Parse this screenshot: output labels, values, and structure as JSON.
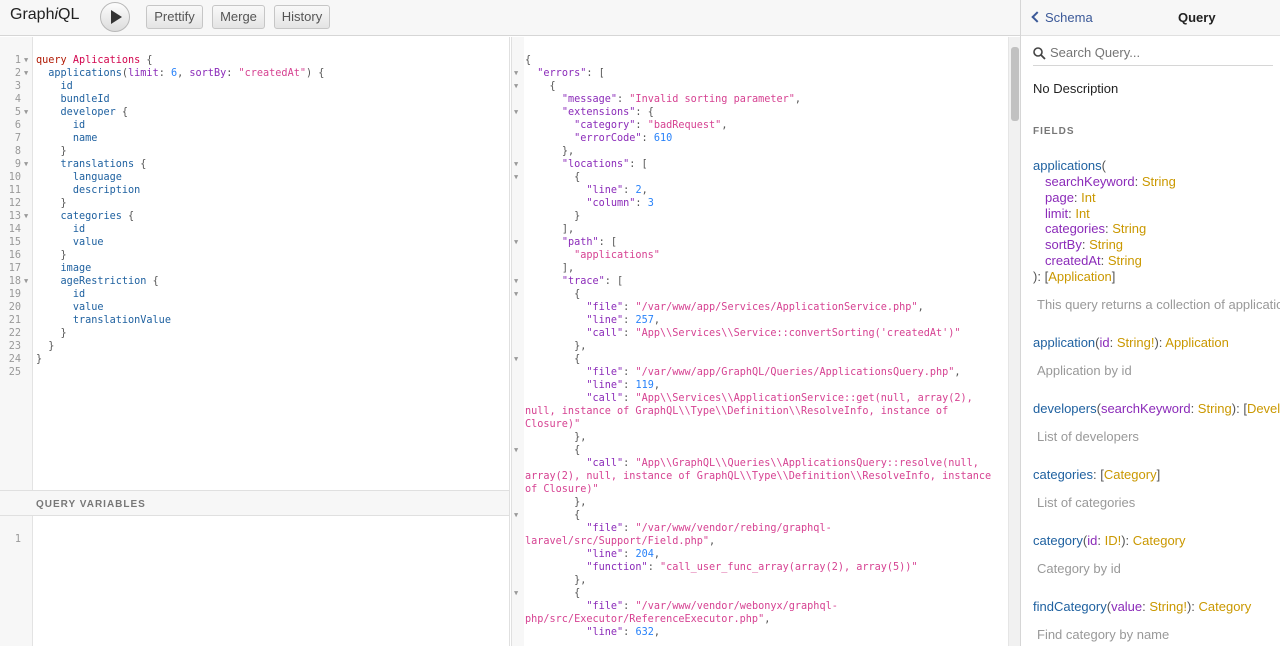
{
  "toolbar": {
    "logo_pre": "Graph",
    "logo_i": "i",
    "logo_post": "QL",
    "run_label": "",
    "prettify_label": "Prettify",
    "merge_label": "Merge",
    "history_label": "History"
  },
  "query_editor": {
    "lines": [
      {
        "n": "1",
        "fold": true,
        "code": "<span class='kw'>query</span> <span class='def'>Aplications</span> <span class='p'>{</span>"
      },
      {
        "n": "2",
        "fold": true,
        "code": "  <span class='field'>applications</span><span class='p'>(</span><span class='attr'>limit</span><span class='p'>:</span> <span class='num'>6</span><span class='p'>,</span> <span class='attr'>sortBy</span><span class='p'>:</span> <span class='str'>\"createdAt\"</span><span class='p'>) {</span>"
      },
      {
        "n": "3",
        "fold": false,
        "code": "    <span class='field'>id</span>"
      },
      {
        "n": "4",
        "fold": false,
        "code": "    <span class='field'>bundleId</span>"
      },
      {
        "n": "5",
        "fold": true,
        "code": "    <span class='field'>developer</span> <span class='p'>{</span>"
      },
      {
        "n": "6",
        "fold": false,
        "code": "      <span class='field'>id</span>"
      },
      {
        "n": "7",
        "fold": false,
        "code": "      <span class='field'>name</span>"
      },
      {
        "n": "8",
        "fold": false,
        "code": "    <span class='p'>}</span>"
      },
      {
        "n": "9",
        "fold": true,
        "code": "    <span class='field'>translations</span> <span class='p'>{</span>"
      },
      {
        "n": "10",
        "fold": false,
        "code": "      <span class='field'>language</span>"
      },
      {
        "n": "11",
        "fold": false,
        "code": "      <span class='field'>description</span>"
      },
      {
        "n": "12",
        "fold": false,
        "code": "    <span class='p'>}</span>"
      },
      {
        "n": "13",
        "fold": true,
        "code": "    <span class='field'>categories</span> <span class='p'>{</span>"
      },
      {
        "n": "14",
        "fold": false,
        "code": "      <span class='field'>id</span>"
      },
      {
        "n": "15",
        "fold": false,
        "code": "      <span class='field'>value</span>"
      },
      {
        "n": "16",
        "fold": false,
        "code": "    <span class='p'>}</span>"
      },
      {
        "n": "17",
        "fold": false,
        "code": "    <span class='field'>image</span>"
      },
      {
        "n": "18",
        "fold": true,
        "code": "    <span class='field'>ageRestriction</span> <span class='p'>{</span>"
      },
      {
        "n": "19",
        "fold": false,
        "code": "      <span class='field'>id</span>"
      },
      {
        "n": "20",
        "fold": false,
        "code": "      <span class='field'>value</span>"
      },
      {
        "n": "21",
        "fold": false,
        "code": "      <span class='field'>translationValue</span>"
      },
      {
        "n": "22",
        "fold": false,
        "code": "    <span class='p'>}</span>"
      },
      {
        "n": "23",
        "fold": false,
        "code": "  <span class='p'>}</span>"
      },
      {
        "n": "24",
        "fold": false,
        "code": "<span class='p'>}</span>"
      },
      {
        "n": "25",
        "fold": false,
        "code": ""
      }
    ]
  },
  "variables": {
    "title": "QUERY VARIABLES",
    "line_number": "1"
  },
  "result": {
    "lines": [
      {
        "fold": false,
        "code": "<span class='p'>{</span>"
      },
      {
        "fold": true,
        "code": "  <span class='attr'>\"errors\"</span><span class='p'>: [</span>"
      },
      {
        "fold": true,
        "code": "    <span class='p'>{</span>"
      },
      {
        "fold": false,
        "code": "      <span class='attr'>\"message\"</span><span class='p'>:</span> <span class='str'>\"Invalid sorting parameter\"</span><span class='p'>,</span>"
      },
      {
        "fold": true,
        "code": "      <span class='attr'>\"extensions\"</span><span class='p'>: {</span>"
      },
      {
        "fold": false,
        "code": "        <span class='attr'>\"category\"</span><span class='p'>:</span> <span class='str'>\"badRequest\"</span><span class='p'>,</span>"
      },
      {
        "fold": false,
        "code": "        <span class='attr'>\"errorCode\"</span><span class='p'>:</span> <span class='num'>610</span>"
      },
      {
        "fold": false,
        "code": "      <span class='p'>},</span>"
      },
      {
        "fold": true,
        "code": "      <span class='attr'>\"locations\"</span><span class='p'>: [</span>"
      },
      {
        "fold": true,
        "code": "        <span class='p'>{</span>"
      },
      {
        "fold": false,
        "code": "          <span class='attr'>\"line\"</span><span class='p'>:</span> <span class='num'>2</span><span class='p'>,</span>"
      },
      {
        "fold": false,
        "code": "          <span class='attr'>\"column\"</span><span class='p'>:</span> <span class='num'>3</span>"
      },
      {
        "fold": false,
        "code": "        <span class='p'>}</span>"
      },
      {
        "fold": false,
        "code": "      <span class='p'>],</span>"
      },
      {
        "fold": true,
        "code": "      <span class='attr'>\"path\"</span><span class='p'>: [</span>"
      },
      {
        "fold": false,
        "code": "        <span class='str'>\"applications\"</span>"
      },
      {
        "fold": false,
        "code": "      <span class='p'>],</span>"
      },
      {
        "fold": true,
        "code": "      <span class='attr'>\"trace\"</span><span class='p'>: [</span>"
      },
      {
        "fold": true,
        "code": "        <span class='p'>{</span>"
      },
      {
        "fold": false,
        "code": "          <span class='attr'>\"file\"</span><span class='p'>:</span> <span class='str'>\"/var/www/app/Services/ApplicationService.php\"</span><span class='p'>,</span>"
      },
      {
        "fold": false,
        "code": "          <span class='attr'>\"line\"</span><span class='p'>:</span> <span class='num'>257</span><span class='p'>,</span>"
      },
      {
        "fold": false,
        "code": "          <span class='attr'>\"call\"</span><span class='p'>:</span> <span class='str'>\"App\\\\Services\\\\Service::convertSorting('createdAt')\"</span>"
      },
      {
        "fold": false,
        "code": "        <span class='p'>},</span>"
      },
      {
        "fold": true,
        "code": "        <span class='p'>{</span>"
      },
      {
        "fold": false,
        "code": "          <span class='attr'>\"file\"</span><span class='p'>:</span> <span class='str'>\"/var/www/app/GraphQL/Queries/ApplicationsQuery.php\"</span><span class='p'>,</span>"
      },
      {
        "fold": false,
        "code": "          <span class='attr'>\"line\"</span><span class='p'>:</span> <span class='num'>119</span><span class='p'>,</span>"
      },
      {
        "fold": false,
        "code": "          <span class='attr'>\"call\"</span><span class='p'>:</span> <span class='str'>\"App\\\\Services\\\\ApplicationService::get(null, array(2),</span>"
      },
      {
        "fold": false,
        "cont": true,
        "code": "<span class='str'>null, instance of GraphQL\\\\Type\\\\Definition\\\\ResolveInfo, instance of</span>"
      },
      {
        "fold": false,
        "cont": true,
        "code": "<span class='str'>Closure)\"</span>"
      },
      {
        "fold": false,
        "code": "        <span class='p'>},</span>"
      },
      {
        "fold": true,
        "code": "        <span class='p'>{</span>"
      },
      {
        "fold": false,
        "code": "          <span class='attr'>\"call\"</span><span class='p'>:</span> <span class='str'>\"App\\\\GraphQL\\\\Queries\\\\ApplicationsQuery::resolve(null,</span>"
      },
      {
        "fold": false,
        "cont": true,
        "code": "<span class='str'>array(2), null, instance of GraphQL\\\\Type\\\\Definition\\\\ResolveInfo, instance</span>"
      },
      {
        "fold": false,
        "cont": true,
        "code": "<span class='str'>of Closure)\"</span>"
      },
      {
        "fold": false,
        "code": "        <span class='p'>},</span>"
      },
      {
        "fold": true,
        "code": "        <span class='p'>{</span>"
      },
      {
        "fold": false,
        "code": "          <span class='attr'>\"file\"</span><span class='p'>:</span> <span class='str'>\"/var/www/vendor/rebing/graphql-</span>"
      },
      {
        "fold": false,
        "cont": true,
        "code": "<span class='str'>laravel/src/Support/Field.php\"</span><span class='p'>,</span>"
      },
      {
        "fold": false,
        "code": "          <span class='attr'>\"line\"</span><span class='p'>:</span> <span class='num'>204</span><span class='p'>,</span>"
      },
      {
        "fold": false,
        "code": "          <span class='attr'>\"function\"</span><span class='p'>:</span> <span class='str'>\"call_user_func_array(array(2), array(5))\"</span>"
      },
      {
        "fold": false,
        "code": "        <span class='p'>},</span>"
      },
      {
        "fold": true,
        "code": "        <span class='p'>{</span>"
      },
      {
        "fold": false,
        "code": "          <span class='attr'>\"file\"</span><span class='p'>:</span> <span class='str'>\"/var/www/vendor/webonyx/graphql-</span>"
      },
      {
        "fold": false,
        "cont": true,
        "code": "<span class='str'>php/src/Executor/ReferenceExecutor.php\"</span><span class='p'>,</span>"
      },
      {
        "fold": false,
        "code": "          <span class='attr'>\"line\"</span><span class='p'>:</span> <span class='num'>632</span><span class='p'>,</span>"
      }
    ]
  },
  "docs": {
    "back_label": "Schema",
    "title": "Query",
    "search_placeholder": "Search Query...",
    "no_description": "No Description",
    "fields_title": "FIELDS",
    "applications": {
      "name": "applications",
      "open": "(",
      "args": [
        {
          "name": "searchKeyword",
          "type": "String"
        },
        {
          "name": "page",
          "type": "Int"
        },
        {
          "name": "limit",
          "type": "Int"
        },
        {
          "name": "categories",
          "type": "String"
        },
        {
          "name": "sortBy",
          "type": "String"
        },
        {
          "name": "createdAt",
          "type": "String"
        }
      ],
      "close": "): ",
      "type_open": "[",
      "type": "Application",
      "type_close": "]",
      "desc": "This query returns a collection of applications"
    },
    "application": {
      "name": "application",
      "arg": "id",
      "arg_type": "String!",
      "type": "Application",
      "desc": "Application by id"
    },
    "developers": {
      "name": "developers",
      "arg": "searchKeyword",
      "arg_type": "String",
      "type": "Developer",
      "desc": "List of developers"
    },
    "categories": {
      "name": "categories",
      "type": "Category",
      "desc": "List of categories"
    },
    "category": {
      "name": "category",
      "arg": "id",
      "arg_type": "ID!",
      "type": "Category",
      "desc": "Category by id"
    },
    "findCategory": {
      "name": "findCategory",
      "arg": "value",
      "arg_type": "String!",
      "type": "Category",
      "desc": "Find category by name"
    }
  }
}
